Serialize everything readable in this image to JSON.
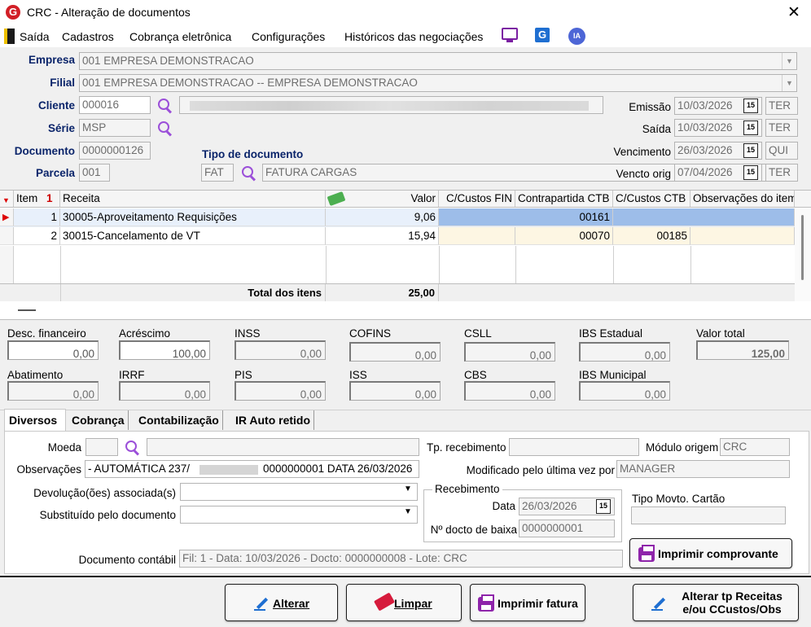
{
  "window": {
    "title": "CRC - Alteração de documentos",
    "close": "✕"
  },
  "menu": [
    "Saída",
    "Cadastros",
    "Cobrança eletrônica",
    "Configurações",
    "Históricos das negociações"
  ],
  "menu_extra": {
    "g": "G",
    "ia": "IA"
  },
  "header": {
    "empresa_label": "Empresa",
    "empresa": "001 EMPRESA DEMONSTRACAO",
    "filial_label": "Filial",
    "filial": "001 EMPRESA DEMONSTRACAO -- EMPRESA DEMONSTRACAO",
    "cliente_label": "Cliente",
    "cliente": "000016",
    "serie_label": "Série",
    "serie": "MSP",
    "documento_label": "Documento",
    "documento": "0000000126",
    "parcela_label": "Parcela",
    "parcela": "001",
    "tipo_doc_label": "Tipo de documento",
    "tipo_doc_code": "FAT",
    "tipo_doc_desc": "FATURA CARGAS",
    "emissao_label": "Emissão",
    "emissao": "10/03/2026",
    "emissao_dia": "TER",
    "saida_label": "Saída",
    "saida": "10/03/2026",
    "saida_dia": "TER",
    "vencimento_label": "Vencimento",
    "vencimento": "26/03/2026",
    "vencimento_dia": "QUI",
    "vencto_orig_label": "Vencto orig",
    "vencto_orig": "07/04/2026",
    "vencto_orig_dia": "TER",
    "cal_icon": "15"
  },
  "grid": {
    "headers": [
      "Item",
      "Receita",
      "Valor",
      "C/Custos FIN",
      "Contrapartida CTB",
      "C/Custos CTB",
      "Observações do item"
    ],
    "sort_icon": "1",
    "rows": [
      {
        "item": "1",
        "receita": "30005-Aproveitamento Requisições",
        "valor": "9,06",
        "ccfin": "",
        "contra": "00161",
        "ccctb": "",
        "obs": ""
      },
      {
        "item": "2",
        "receita": "30015-Cancelamento de VT",
        "valor": "15,94",
        "ccfin": "",
        "contra": "00070",
        "ccctb": "00185",
        "obs": ""
      }
    ],
    "total_label": "Total dos itens",
    "total": "25,00"
  },
  "totals": {
    "desc_fin_label": "Desc. financeiro",
    "desc_fin": "0,00",
    "acrescimo_label": "Acréscimo",
    "acrescimo": "100,00",
    "inss_label": "INSS",
    "inss": "0,00",
    "cofins_label": "COFINS",
    "cofins": "0,00",
    "csll_label": "CSLL",
    "csll": "0,00",
    "ibs_est_label": "IBS Estadual",
    "ibs_est": "0,00",
    "valor_total_label": "Valor total",
    "valor_total": "125,00",
    "abatimento_label": "Abatimento",
    "abatimento": "0,00",
    "irrf_label": "IRRF",
    "irrf": "0,00",
    "pis_label": "PIS",
    "pis": "0,00",
    "iss_label": "ISS",
    "iss": "0,00",
    "cbs_label": "CBS",
    "cbs": "0,00",
    "ibs_mun_label": "IBS Municipal",
    "ibs_mun": "0,00"
  },
  "tabs": [
    "Diversos",
    "Cobrança",
    "Contabilização",
    "IR Auto retido"
  ],
  "diversos": {
    "moeda_label": "Moeda",
    "moeda": "",
    "obs_label": "Observações",
    "obs_pre": "- AUTOMÁTICA 237/",
    "obs_post": "0000000001 DATA 26/03/2026",
    "devol_label": "Devolução(ões) associada(s)",
    "subst_label": "Substituído pelo documento",
    "tp_receb_label": "Tp. recebimento",
    "tp_receb": "",
    "modulo_label": "Módulo origem",
    "modulo": "CRC",
    "modif_label": "Modificado pelo última vez por",
    "modif": "MANAGER",
    "receb_group": "Recebimento",
    "data_label": "Data",
    "data": "26/03/2026",
    "docto_baixa_label": "Nº docto de baixa",
    "docto_baixa": "0000000001",
    "tipo_cartao_label": "Tipo Movto. Cartão",
    "tipo_cartao": "",
    "doc_contabil_label": "Documento contábil",
    "doc_contabil": "Fil: 1 - Data: 10/03/2026 - Docto: 0000000008 - Lote: CRC",
    "imprimir_comprovante": "Imprimir comprovante"
  },
  "buttons": {
    "alterar": "Alterar",
    "limpar": "Limpar",
    "imprimir_fatura": "Imprimir fatura",
    "alterar_tp_1": "Alterar tp Receitas",
    "alterar_tp_2": "e/ou CCustos/Obs"
  },
  "colors": {
    "accent": "#0a246a",
    "selected_row": "#9dbde9",
    "ccfin_col": "#fdf6e3",
    "icon_purple": "#9b4fd9",
    "logo_red": "#d21f26"
  },
  "icons": [
    "app-logo-icon",
    "close-icon",
    "exit-icon",
    "monitor-icon",
    "g-icon",
    "ia-icon",
    "search-icon",
    "calendar-icon",
    "money-icon",
    "pencil-icon",
    "eraser-icon",
    "printer-icon",
    "dropdown-arrow-icon"
  ]
}
